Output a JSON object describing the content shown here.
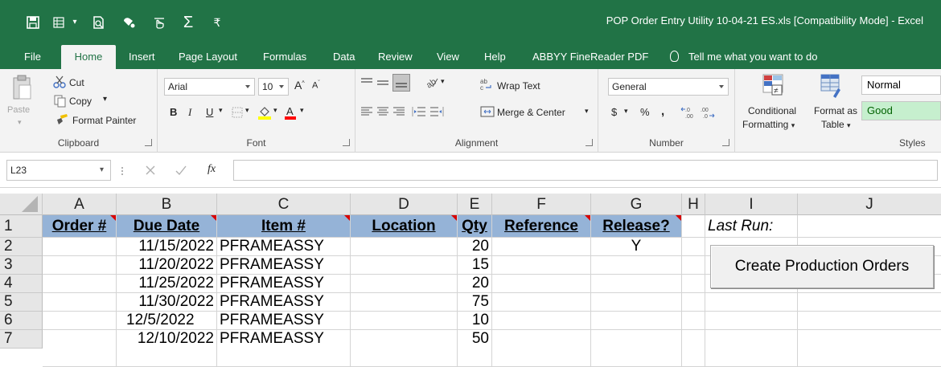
{
  "window_title": "POP Order Entry Utility 10-04-21 ES.xls  [Compatibility Mode]  -  Excel",
  "quick_access": [
    "save-icon",
    "table-icon",
    "print-preview-icon",
    "paint-icon",
    "touch-icon",
    "autosum-icon",
    "customize-icon"
  ],
  "quick_access_glyphs": {
    "autosum": "Σ",
    "customize": "₹"
  },
  "tabs": [
    "File",
    "Home",
    "Insert",
    "Page Layout",
    "Formulas",
    "Data",
    "Review",
    "View",
    "Help",
    "ABBYY FineReader PDF"
  ],
  "active_tab": "Home",
  "tell_me": "Tell me what you want to do",
  "ribbon": {
    "clipboard": {
      "paste": "Paste",
      "cut": "Cut",
      "copy": "Copy",
      "format_painter": "Format Painter",
      "label": "Clipboard"
    },
    "font": {
      "name": "Arial",
      "size": "10",
      "bold": "B",
      "italic": "I",
      "underline": "U",
      "label": "Font"
    },
    "alignment": {
      "wrap_text": "Wrap Text",
      "merge_center": "Merge & Center",
      "label": "Alignment"
    },
    "number": {
      "format": "General",
      "currency": "$",
      "percent": "%",
      "comma": ",",
      "label": "Number"
    },
    "styles": {
      "conditional_line1": "Conditional",
      "conditional_line2": "Formatting",
      "table_line1": "Format as",
      "table_line2": "Table",
      "normal": "Normal",
      "good": "Good",
      "label": "Styles"
    }
  },
  "formula_bar": {
    "name_box": "L23",
    "fx": "fx",
    "value": ""
  },
  "columns": [
    "A",
    "B",
    "C",
    "D",
    "E",
    "F",
    "G",
    "H",
    "I",
    "J"
  ],
  "rows": [
    "1",
    "2",
    "3",
    "4",
    "5",
    "6",
    "7"
  ],
  "table_headers": {
    "order": "Order #",
    "due_date": "Due Date",
    "item": "Item #",
    "location": "Location",
    "qty": "Qty",
    "reference": "Reference",
    "release": "Release?"
  },
  "last_run_label": "Last Run:",
  "data_rows": [
    {
      "due_date": "11/15/2022",
      "item": "PFRAMEASSY",
      "qty": "20",
      "release": "Y"
    },
    {
      "due_date": "11/20/2022",
      "item": "PFRAMEASSY",
      "qty": "15",
      "release": ""
    },
    {
      "due_date": "11/25/2022",
      "item": "PFRAMEASSY",
      "qty": "20",
      "release": ""
    },
    {
      "due_date": "11/30/2022",
      "item": "PFRAMEASSY",
      "qty": "75",
      "release": ""
    },
    {
      "due_date": "12/5/2022",
      "item": "PFRAMEASSY",
      "qty": "10",
      "release": ""
    },
    {
      "due_date": "12/10/2022",
      "item": "PFRAMEASSY",
      "qty": "50",
      "release": ""
    }
  ],
  "create_button": "Create Production Orders",
  "colors": {
    "excel_green": "#217346",
    "header_fill": "#95b3d7",
    "good_fill": "#c6efce",
    "good_text": "#006100"
  }
}
